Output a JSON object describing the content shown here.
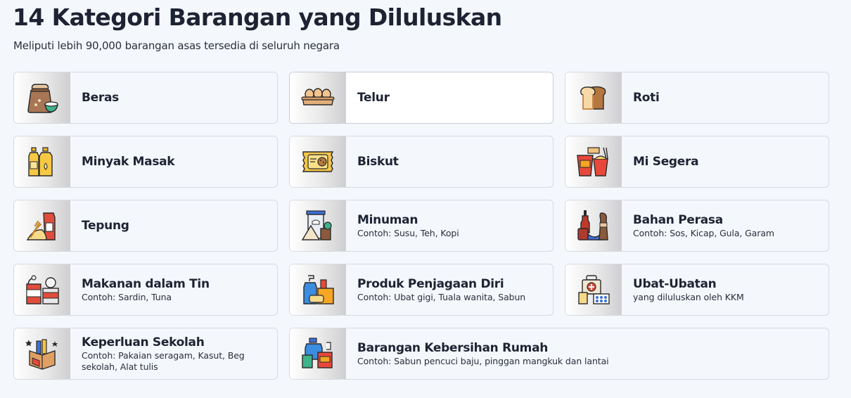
{
  "header": {
    "title": "14 Kategori Barangan yang Diluluskan",
    "subtitle": "Meliputi lebih 90,000 barangan asas tersedia di seluruh negara"
  },
  "categories": [
    {
      "label": "Beras",
      "desc": "",
      "icon": "rice-sack-icon"
    },
    {
      "label": "Telur",
      "desc": "",
      "icon": "egg-tray-icon"
    },
    {
      "label": "Roti",
      "desc": "",
      "icon": "bread-icon"
    },
    {
      "label": "Minyak Masak",
      "desc": "",
      "icon": "cooking-oil-icon"
    },
    {
      "label": "Biskut",
      "desc": "",
      "icon": "biscuit-icon"
    },
    {
      "label": "Mi Segera",
      "desc": "",
      "icon": "instant-noodle-icon"
    },
    {
      "label": "Tepung",
      "desc": "",
      "icon": "flour-icon"
    },
    {
      "label": "Minuman",
      "desc": "Contoh: Susu, Teh, Kopi",
      "icon": "beverage-icon"
    },
    {
      "label": "Bahan Perasa",
      "desc": "Contoh: Sos, Kicap, Gula, Garam",
      "icon": "condiment-icon"
    },
    {
      "label": "Makanan dalam Tin",
      "desc": "Contoh: Sardin, Tuna",
      "icon": "canned-food-icon"
    },
    {
      "label": "Produk Penjagaan Diri",
      "desc": "Contoh: Ubat gigi, Tuala wanita, Sabun",
      "icon": "personal-care-icon"
    },
    {
      "label": "Ubat-Ubatan",
      "desc": "yang diluluskan oleh KKM",
      "icon": "medicine-icon"
    },
    {
      "label": "Keperluan Sekolah",
      "desc": "Contoh: Pakaian seragam, Kasut, Beg sekolah, Alat tulis",
      "icon": "school-supplies-icon"
    },
    {
      "label": "Barangan Kebersihan Rumah",
      "desc": "Contoh: Sabun pencuci baju, pinggan mangkuk dan lantai",
      "icon": "household-cleaning-icon"
    }
  ],
  "colors": {
    "background": "#f4f7fc",
    "card_border": "#d6dbe3",
    "active_card": "#ffffff",
    "text_primary": "#1e2333"
  }
}
